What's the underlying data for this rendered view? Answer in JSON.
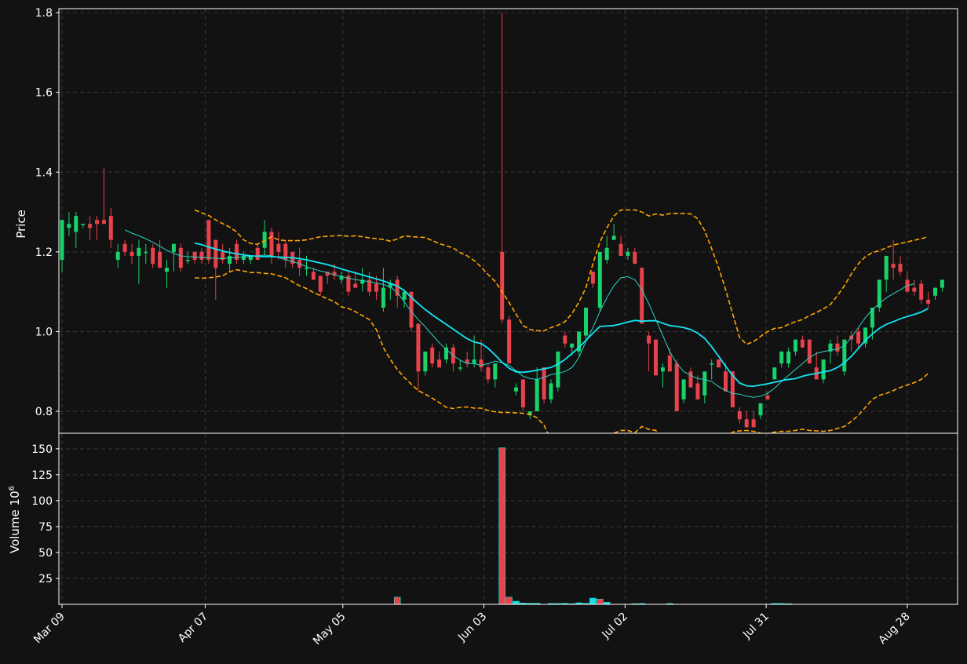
{
  "chart_data": {
    "type": "candlestick",
    "colors": {
      "background": "#121212",
      "axes": "#ffffff",
      "grid": "#3a3a3a",
      "up": "#17d36a",
      "down": "#e8424b",
      "ma_fast": "#2ad4c6",
      "ma_slow": "#13e6f5",
      "bands": "#ffa500",
      "volume_up": "#13dfe0",
      "volume_down": "#e8424b"
    },
    "price_panel": {
      "ylabel": "Price",
      "ylim": [
        0.745,
        1.81
      ],
      "yticks": [
        "0.8",
        "1.0",
        "1.2",
        "1.4",
        "1.6",
        "1.8"
      ],
      "grid": true
    },
    "volume_panel": {
      "ylabel": "Volume",
      "ylabel_exponent": "6",
      "ylim": [
        0,
        165
      ],
      "yticks": [
        "25",
        "50",
        "75",
        "100",
        "125",
        "150"
      ],
      "grid": true
    },
    "x_axis": {
      "n_candles": 130,
      "tick_labels": [
        "Mar 09",
        "Apr 07",
        "May 05",
        "Jun 03",
        "Jul 02",
        "Jul 31",
        "Aug 28"
      ],
      "tick_index": [
        0,
        20.5,
        40.2,
        60.4,
        80.6,
        100.8,
        121
      ]
    },
    "candles_ohlc": [
      [
        1.18,
        1.28,
        1.15,
        1.28
      ],
      [
        1.26,
        1.3,
        1.24,
        1.27
      ],
      [
        1.25,
        1.3,
        1.21,
        1.29
      ],
      [
        1.27,
        1.27,
        1.26,
        1.27
      ],
      [
        1.27,
        1.29,
        1.23,
        1.26
      ],
      [
        1.28,
        1.29,
        1.23,
        1.27
      ],
      [
        1.28,
        1.41,
        1.27,
        1.27
      ],
      [
        1.29,
        1.31,
        1.21,
        1.23
      ],
      [
        1.18,
        1.22,
        1.16,
        1.2
      ],
      [
        1.22,
        1.23,
        1.19,
        1.2
      ],
      [
        1.2,
        1.22,
        1.17,
        1.19
      ],
      [
        1.19,
        1.23,
        1.12,
        1.21
      ],
      [
        1.2,
        1.22,
        1.17,
        1.2
      ],
      [
        1.21,
        1.22,
        1.16,
        1.17
      ],
      [
        1.2,
        1.23,
        1.16,
        1.16
      ],
      [
        1.15,
        1.18,
        1.11,
        1.16
      ],
      [
        1.2,
        1.22,
        1.15,
        1.22
      ],
      [
        1.21,
        1.22,
        1.15,
        1.16
      ],
      [
        1.18,
        1.2,
        1.17,
        1.18
      ],
      [
        1.2,
        1.2,
        1.17,
        1.18
      ],
      [
        1.2,
        1.21,
        1.17,
        1.18
      ],
      [
        1.28,
        1.28,
        1.17,
        1.18
      ],
      [
        1.23,
        1.23,
        1.08,
        1.16
      ],
      [
        1.2,
        1.22,
        1.17,
        1.18
      ],
      [
        1.17,
        1.21,
        1.15,
        1.19
      ],
      [
        1.22,
        1.23,
        1.17,
        1.18
      ],
      [
        1.18,
        1.2,
        1.17,
        1.19
      ],
      [
        1.18,
        1.19,
        1.17,
        1.19
      ],
      [
        1.21,
        1.22,
        1.18,
        1.18
      ],
      [
        1.21,
        1.28,
        1.19,
        1.25
      ],
      [
        1.25,
        1.26,
        1.17,
        1.19
      ],
      [
        1.22,
        1.25,
        1.18,
        1.2
      ],
      [
        1.22,
        1.23,
        1.16,
        1.18
      ],
      [
        1.2,
        1.2,
        1.16,
        1.17
      ],
      [
        1.18,
        1.21,
        1.14,
        1.16
      ],
      [
        1.16,
        1.19,
        1.14,
        1.16
      ],
      [
        1.15,
        1.16,
        1.13,
        1.13
      ],
      [
        1.14,
        1.14,
        1.09,
        1.1
      ],
      [
        1.15,
        1.15,
        1.12,
        1.14
      ],
      [
        1.15,
        1.17,
        1.13,
        1.14
      ],
      [
        1.13,
        1.15,
        1.12,
        1.14
      ],
      [
        1.14,
        1.15,
        1.09,
        1.1
      ],
      [
        1.12,
        1.15,
        1.11,
        1.11
      ],
      [
        1.12,
        1.16,
        1.1,
        1.13
      ],
      [
        1.13,
        1.15,
        1.09,
        1.1
      ],
      [
        1.12,
        1.14,
        1.08,
        1.1
      ],
      [
        1.06,
        1.16,
        1.05,
        1.11
      ],
      [
        1.11,
        1.13,
        1.08,
        1.12
      ],
      [
        1.13,
        1.14,
        1.06,
        1.09
      ],
      [
        1.08,
        1.1,
        1.06,
        1.1
      ],
      [
        1.1,
        1.1,
        1.0,
        1.01
      ],
      [
        1.02,
        1.02,
        0.85,
        0.9
      ],
      [
        0.9,
        0.95,
        0.89,
        0.95
      ],
      [
        0.96,
        0.97,
        0.91,
        0.92
      ],
      [
        0.93,
        0.95,
        0.91,
        0.91
      ],
      [
        0.93,
        0.97,
        0.92,
        0.96
      ],
      [
        0.96,
        0.97,
        0.9,
        0.92
      ],
      [
        0.91,
        0.93,
        0.9,
        0.91
      ],
      [
        0.93,
        0.95,
        0.91,
        0.92
      ],
      [
        0.92,
        0.99,
        0.91,
        0.93
      ],
      [
        0.93,
        0.98,
        0.9,
        0.91
      ],
      [
        0.91,
        0.92,
        0.87,
        0.88
      ],
      [
        0.88,
        0.92,
        0.86,
        0.92
      ],
      [
        1.2,
        1.8,
        1.02,
        1.03
      ],
      [
        1.03,
        1.04,
        0.92,
        0.92
      ],
      [
        0.85,
        0.87,
        0.84,
        0.86
      ],
      [
        0.88,
        0.88,
        0.8,
        0.81
      ],
      [
        0.79,
        0.8,
        0.78,
        0.8
      ],
      [
        0.8,
        0.91,
        0.8,
        0.88
      ],
      [
        0.91,
        0.91,
        0.82,
        0.83
      ],
      [
        0.83,
        0.88,
        0.82,
        0.87
      ],
      [
        0.86,
        0.95,
        0.85,
        0.95
      ],
      [
        0.99,
        1.0,
        0.96,
        0.97
      ],
      [
        0.96,
        0.97,
        0.94,
        0.97
      ],
      [
        0.95,
        1.0,
        0.94,
        1.0
      ],
      [
        0.99,
        1.06,
        0.98,
        1.06
      ],
      [
        1.15,
        1.15,
        1.11,
        1.12
      ],
      [
        1.06,
        1.2,
        1.05,
        1.2
      ],
      [
        1.18,
        1.24,
        1.17,
        1.21
      ],
      [
        1.23,
        1.27,
        1.23,
        1.24
      ],
      [
        1.22,
        1.24,
        1.19,
        1.19
      ],
      [
        1.19,
        1.21,
        1.18,
        1.2
      ],
      [
        1.2,
        1.21,
        1.18,
        1.17
      ],
      [
        1.16,
        1.16,
        1.02,
        1.02
      ],
      [
        0.99,
        1.0,
        0.9,
        0.97
      ],
      [
        0.98,
        0.98,
        0.89,
        0.89
      ],
      [
        0.9,
        0.92,
        0.86,
        0.91
      ],
      [
        0.94,
        0.96,
        0.9,
        0.9
      ],
      [
        0.92,
        0.93,
        0.8,
        0.8
      ],
      [
        0.83,
        0.88,
        0.82,
        0.88
      ],
      [
        0.9,
        0.91,
        0.86,
        0.86
      ],
      [
        0.87,
        0.89,
        0.83,
        0.83
      ],
      [
        0.84,
        0.9,
        0.82,
        0.9
      ],
      [
        0.92,
        0.93,
        0.88,
        0.92
      ],
      [
        0.93,
        0.93,
        0.91,
        0.91
      ],
      [
        0.9,
        0.92,
        0.85,
        0.85
      ],
      [
        0.9,
        0.9,
        0.81,
        0.81
      ],
      [
        0.8,
        0.81,
        0.77,
        0.78
      ],
      [
        0.78,
        0.8,
        0.76,
        0.76
      ],
      [
        0.78,
        0.8,
        0.76,
        0.76
      ],
      [
        0.79,
        0.82,
        0.78,
        0.82
      ],
      [
        0.84,
        0.85,
        0.83,
        0.83
      ],
      [
        0.88,
        0.91,
        0.88,
        0.91
      ],
      [
        0.92,
        0.95,
        0.91,
        0.95
      ],
      [
        0.92,
        0.96,
        0.91,
        0.95
      ],
      [
        0.95,
        0.97,
        0.94,
        0.98
      ],
      [
        0.98,
        0.99,
        0.96,
        0.96
      ],
      [
        0.98,
        0.98,
        0.92,
        0.92
      ],
      [
        0.91,
        0.95,
        0.89,
        0.88
      ],
      [
        0.88,
        0.93,
        0.87,
        0.93
      ],
      [
        0.95,
        0.98,
        0.92,
        0.97
      ],
      [
        0.97,
        0.99,
        0.94,
        0.95
      ],
      [
        0.9,
        0.98,
        0.89,
        0.98
      ],
      [
        0.99,
        1.0,
        0.95,
        0.98
      ],
      [
        1.0,
        1.01,
        0.96,
        0.97
      ],
      [
        0.97,
        1.01,
        0.96,
        1.01
      ],
      [
        1.01,
        1.06,
        0.98,
        1.06
      ],
      [
        1.06,
        1.13,
        1.05,
        1.13
      ],
      [
        1.13,
        1.19,
        1.1,
        1.19
      ],
      [
        1.17,
        1.23,
        1.13,
        1.16
      ],
      [
        1.17,
        1.19,
        1.14,
        1.15
      ],
      [
        1.13,
        1.15,
        1.1,
        1.1
      ],
      [
        1.11,
        1.13,
        1.09,
        1.1
      ],
      [
        1.12,
        1.13,
        1.07,
        1.08
      ],
      [
        1.08,
        1.1,
        1.06,
        1.07
      ],
      [
        1.09,
        1.11,
        1.08,
        1.11
      ],
      [
        1.11,
        1.13,
        1.1,
        1.13
      ]
    ],
    "volume_millions": [
      [
        48,
        7,
        "down"
      ],
      [
        63,
        151,
        "down"
      ],
      [
        64,
        7,
        "down"
      ],
      [
        65,
        3,
        "up"
      ],
      [
        66,
        1.2,
        "up"
      ],
      [
        67,
        1,
        "up"
      ],
      [
        68,
        1,
        "up"
      ],
      [
        70,
        0.8,
        "up"
      ],
      [
        71,
        0.8,
        "up"
      ],
      [
        72,
        1,
        "up"
      ],
      [
        73,
        0.6,
        "up"
      ],
      [
        74,
        1.5,
        "up"
      ],
      [
        75,
        1,
        "up"
      ],
      [
        76,
        6,
        "up"
      ],
      [
        77,
        5,
        "down"
      ],
      [
        78,
        2,
        "up"
      ],
      [
        82,
        0.6,
        "up"
      ],
      [
        83,
        0.8,
        "up"
      ],
      [
        87,
        0.8,
        "up"
      ],
      [
        102,
        0.8,
        "up"
      ],
      [
        103,
        0.8,
        "up"
      ],
      [
        104,
        0.6,
        "up"
      ]
    ],
    "ma_fast_start": 9,
    "ma_fast": [
      1.255,
      1.247,
      1.24,
      1.233,
      1.224,
      1.214,
      1.204,
      1.196,
      1.19,
      1.188,
      1.187,
      1.186,
      1.185,
      1.184,
      1.183,
      1.185,
      1.186,
      1.187,
      1.188,
      1.19,
      1.192,
      1.19,
      1.186,
      1.18,
      1.176,
      1.17,
      1.163,
      1.157,
      1.152,
      1.148,
      1.142,
      1.138,
      1.134,
      1.13,
      1.128,
      1.125,
      1.122,
      1.118,
      1.112,
      1.098,
      1.075,
      1.05,
      1.03,
      1.012,
      0.992,
      0.972,
      0.955,
      0.94,
      0.928,
      0.92,
      0.92,
      0.915,
      0.92,
      0.926,
      0.922,
      0.915,
      0.902,
      0.888,
      0.882,
      0.88,
      0.885,
      0.892,
      0.895,
      0.9,
      0.91,
      0.935,
      0.975,
      1.01,
      1.05,
      1.085,
      1.115,
      1.135,
      1.138,
      1.13,
      1.105,
      1.07,
      1.03,
      0.99,
      0.95,
      0.92,
      0.9,
      0.89,
      0.882,
      0.88,
      0.875,
      0.862,
      0.852,
      0.845,
      0.843,
      0.838,
      0.835,
      0.838,
      0.845,
      0.858,
      0.875,
      0.89,
      0.905,
      0.92,
      0.935,
      0.945,
      0.95,
      0.953,
      0.956,
      0.965,
      0.985,
      1.01,
      1.035,
      1.055,
      1.07,
      1.085,
      1.095,
      1.105,
      1.115,
      1.12
    ],
    "ma_slow_start": 19,
    "ma_slow": [
      1.222,
      1.218,
      1.212,
      1.207,
      1.202,
      1.198,
      1.195,
      1.192,
      1.19,
      1.189,
      1.188,
      1.188,
      1.187,
      1.186,
      1.185,
      1.183,
      1.18,
      1.176,
      1.172,
      1.168,
      1.163,
      1.157,
      1.152,
      1.147,
      1.142,
      1.137,
      1.132,
      1.127,
      1.121,
      1.114,
      1.103,
      1.086,
      1.07,
      1.055,
      1.042,
      1.03,
      1.018,
      1.006,
      0.994,
      0.982,
      0.974,
      0.97,
      0.958,
      0.941,
      0.923,
      0.908,
      0.899,
      0.898,
      0.9,
      0.903,
      0.907,
      0.91,
      0.918,
      0.93,
      0.945,
      0.96,
      0.978,
      0.996,
      1.013,
      1.014,
      1.015,
      1.019,
      1.024,
      1.028,
      1.026,
      1.027,
      1.027,
      1.021,
      1.015,
      1.013,
      1.01,
      1.005,
      0.996,
      0.983,
      0.962,
      0.938,
      0.913,
      0.89,
      0.871,
      0.864,
      0.863,
      0.866,
      0.869,
      0.873,
      0.877,
      0.88,
      0.882,
      0.888,
      0.892,
      0.895,
      0.899,
      0.902,
      0.91,
      0.922,
      0.938,
      0.958,
      0.978,
      0.994,
      1.008,
      1.018,
      1.025,
      1.032,
      1.038,
      1.043,
      1.049,
      1.058
    ],
    "band_start": 19,
    "band_upper": [
      1.305,
      1.298,
      1.291,
      1.28,
      1.271,
      1.262,
      1.25,
      1.23,
      1.221,
      1.219,
      1.228,
      1.238,
      1.23,
      1.228,
      1.228,
      1.228,
      1.23,
      1.234,
      1.238,
      1.239,
      1.24,
      1.241,
      1.239,
      1.24,
      1.238,
      1.235,
      1.233,
      1.231,
      1.227,
      1.232,
      1.24,
      1.238,
      1.237,
      1.236,
      1.228,
      1.221,
      1.215,
      1.21,
      1.198,
      1.19,
      1.178,
      1.162,
      1.143,
      1.126,
      1.1,
      1.073,
      1.044,
      1.015,
      1.005,
      1.002,
      1.002,
      1.01,
      1.016,
      1.025,
      1.045,
      1.074,
      1.11,
      1.17,
      1.225,
      1.26,
      1.29,
      1.305,
      1.305,
      1.305,
      1.3,
      1.29,
      1.295,
      1.292,
      1.296,
      1.296,
      1.296,
      1.295,
      1.283,
      1.253,
      1.208,
      1.16,
      1.105,
      1.045,
      0.985,
      0.968,
      0.975,
      0.988,
      1.0,
      1.008,
      1.01,
      1.018,
      1.025,
      1.03,
      1.04,
      1.048,
      1.057,
      1.068,
      1.09,
      1.115,
      1.145,
      1.17,
      1.188,
      1.198,
      1.203,
      1.21,
      1.217,
      1.221,
      1.225,
      1.229,
      1.233,
      1.238
    ],
    "band_lower": [
      1.135,
      1.134,
      1.135,
      1.137,
      1.14,
      1.15,
      1.155,
      1.152,
      1.148,
      1.148,
      1.146,
      1.145,
      1.14,
      1.135,
      1.125,
      1.115,
      1.108,
      1.098,
      1.09,
      1.082,
      1.075,
      1.062,
      1.058,
      1.05,
      1.04,
      1.03,
      1.005,
      0.96,
      0.93,
      0.905,
      0.885,
      0.868,
      0.852,
      0.843,
      0.833,
      0.822,
      0.81,
      0.807,
      0.81,
      0.811,
      0.808,
      0.808,
      0.802,
      0.799,
      0.797,
      0.797,
      0.796,
      0.795,
      0.792,
      0.784,
      0.765,
      0.728,
      0.695,
      0.682,
      0.672,
      0.66,
      0.65,
      0.66,
      0.68,
      0.715,
      0.745,
      0.752,
      0.752,
      0.746,
      0.762,
      0.755,
      0.752,
      0.732,
      0.72,
      0.702,
      0.675,
      0.645,
      0.64,
      0.652,
      0.672,
      0.7,
      0.73,
      0.748,
      0.751,
      0.752,
      0.75,
      0.745,
      0.744,
      0.748,
      0.75,
      0.75,
      0.752,
      0.755,
      0.752,
      0.751,
      0.75,
      0.752,
      0.757,
      0.762,
      0.775,
      0.79,
      0.81,
      0.83,
      0.84,
      0.845,
      0.852,
      0.86,
      0.866,
      0.872,
      0.88,
      0.895
    ]
  }
}
